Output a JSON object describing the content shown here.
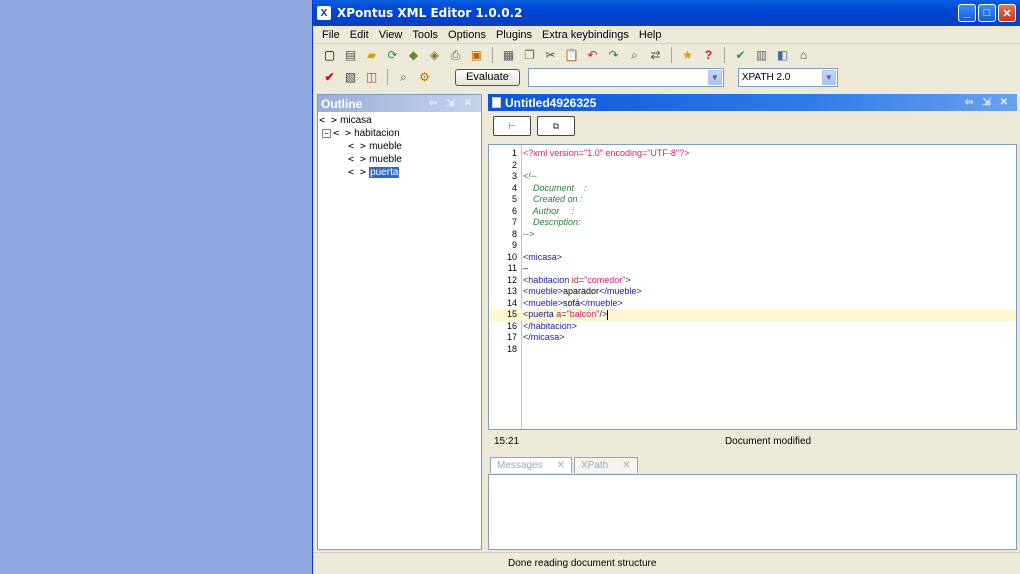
{
  "window": {
    "title": "XPontus XML Editor 1.0.0.2",
    "minimize": "_",
    "maximize": "□",
    "close": "✕"
  },
  "menu": [
    "File",
    "Edit",
    "View",
    "Tools",
    "Options",
    "Plugins",
    "Extra keybindings",
    "Help"
  ],
  "toolbar2": {
    "evaluate_label": "Evaluate",
    "xpath_expression": "",
    "xpath_version": "XPATH 2.0"
  },
  "outline": {
    "title": "Outline",
    "nodes": [
      {
        "label": "micasa",
        "expander": ""
      },
      {
        "label": "habitacion",
        "expander": "−"
      },
      {
        "label": "mueble",
        "expander": ""
      },
      {
        "label": "mueble",
        "expander": ""
      },
      {
        "label": "puerta",
        "expander": ""
      }
    ],
    "tag_glyph": "< >"
  },
  "editor": {
    "tab_title": "Untitled4926325",
    "cursor_position": "15:21",
    "doc_status": "Document modified",
    "lines": [
      {
        "n": "1",
        "parts": [
          [
            "pi",
            "<?xml version=\"1.0\" encoding=\"UTF-8\"?>"
          ]
        ]
      },
      {
        "n": "2",
        "parts": []
      },
      {
        "n": "3",
        "parts": [
          [
            "com",
            "<!--"
          ]
        ]
      },
      {
        "n": "4",
        "parts": [
          [
            "com",
            "    Document    :"
          ]
        ]
      },
      {
        "n": "5",
        "parts": [
          [
            "com",
            "    Created on :"
          ]
        ]
      },
      {
        "n": "6",
        "parts": [
          [
            "com",
            "    Author     :"
          ]
        ]
      },
      {
        "n": "7",
        "parts": [
          [
            "com",
            "    Description:"
          ]
        ]
      },
      {
        "n": "8",
        "parts": [
          [
            "com",
            "-->"
          ]
        ]
      },
      {
        "n": "9",
        "parts": []
      },
      {
        "n": "10",
        "parts": [
          [
            "tag",
            "<micasa>"
          ]
        ]
      },
      {
        "n": "11",
        "parts": [
          [
            "text",
            "–"
          ]
        ]
      },
      {
        "n": "12",
        "parts": [
          [
            "tag",
            "<habitacion "
          ],
          [
            "attr",
            "id"
          ],
          [
            "tag",
            "="
          ],
          [
            "val",
            "\"comedor\""
          ],
          [
            "tag",
            ">"
          ]
        ]
      },
      {
        "n": "13",
        "parts": [
          [
            "tag",
            "<mueble>"
          ],
          [
            "text",
            "aparador"
          ],
          [
            "tag",
            "</mueble>"
          ]
        ]
      },
      {
        "n": "14",
        "parts": [
          [
            "tag",
            "<mueble>"
          ],
          [
            "text",
            "sofá"
          ],
          [
            "tag",
            "</mueble>"
          ]
        ]
      },
      {
        "n": "15",
        "parts": [
          [
            "tag",
            "<puerta "
          ],
          [
            "attr",
            "a"
          ],
          [
            "tag",
            "="
          ],
          [
            "val",
            "\"balcón\""
          ],
          [
            "tag",
            "/>"
          ]
        ],
        "current": true
      },
      {
        "n": "16",
        "parts": [
          [
            "tag",
            "</habitacion>"
          ]
        ]
      },
      {
        "n": "17",
        "parts": [
          [
            "tag",
            "</micasa>"
          ]
        ]
      },
      {
        "n": "18",
        "parts": []
      }
    ]
  },
  "bottom_tabs": [
    {
      "label": "Messages",
      "close": "✕"
    },
    {
      "label": "XPath",
      "close": "✕"
    }
  ],
  "status": "Done reading document structure",
  "colors": {
    "title_bar": "#0a5fdf",
    "selection": "#316ac5",
    "current_line": "#fdf8d2"
  }
}
